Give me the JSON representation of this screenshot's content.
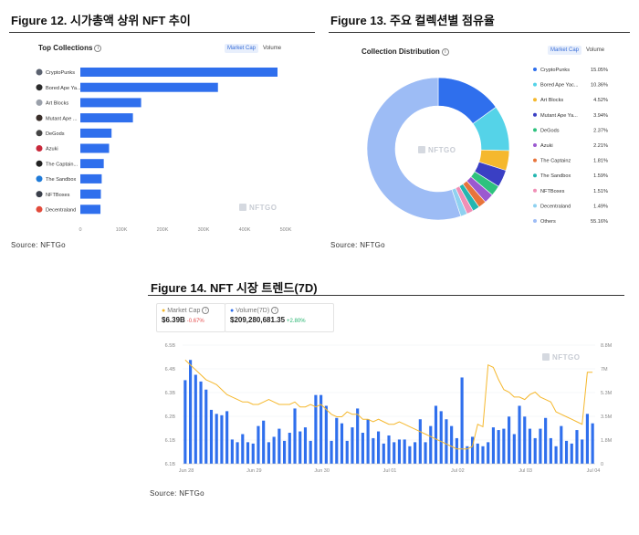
{
  "fig12": {
    "title": "Figure 12. 시가총액 상위 NFT 추이",
    "source": "Source: NFTGo",
    "panel_title": "Top Collections",
    "toggle_a": "Market Cap",
    "toggle_b": "Volume",
    "watermark": "NFTGO"
  },
  "fig13": {
    "title": "Figure 13. 주요 컬렉션별 점유율",
    "source": "Source: NFTGo",
    "panel_title": "Collection Distribution",
    "toggle_a": "Market Cap",
    "toggle_b": "Volume",
    "watermark": "NFTGO"
  },
  "fig14": {
    "title": "Figure 14. NFT 시장 트렌드(7D)",
    "source": "Source: NFTGo",
    "watermark": "NFTGO",
    "mc_label": "Market Cap",
    "mc_value": "$6.39B",
    "mc_change": "-0.67%",
    "vol_label": "Volume(7D)",
    "vol_value": "$209,280,681.35",
    "vol_change": "+2.80%"
  },
  "colors": {
    "bar": "#2f6fed",
    "line": "#f5b82e",
    "neg": "#e54d4d",
    "pos": "#20b26c"
  },
  "chart_data": [
    {
      "type": "bar",
      "orientation": "horizontal",
      "title": "Top Collections",
      "categories": [
        "CryptoPunks",
        "Bored Ape Ya...",
        "Art Blocks",
        "Mutant Ape ...",
        "DeGods",
        "Azuki",
        "The Captain...",
        "The Sandbox",
        "NFTBoxes",
        "Decentraland"
      ],
      "values": [
        480000,
        335000,
        148000,
        128000,
        76000,
        70000,
        57000,
        52000,
        50000,
        49000
      ],
      "xticks": [
        "0",
        "100K",
        "200K",
        "300K",
        "400K",
        "500K"
      ],
      "xlim": [
        0,
        500000
      ]
    },
    {
      "type": "pie",
      "title": "Collection Distribution",
      "labels": [
        "CryptoPunks",
        "Bored Ape Yac...",
        "Art Blocks",
        "Mutant Ape Ya...",
        "DeGods",
        "Azuki",
        "The Captainz",
        "The Sandbox",
        "NFTBoxes",
        "Decentraland",
        "Others"
      ],
      "values": [
        15.05,
        10.36,
        4.52,
        3.94,
        2.37,
        2.21,
        1.81,
        1.59,
        1.51,
        1.49,
        55.16
      ],
      "value_labels": [
        "15.05%",
        "10.36%",
        "4.52%",
        "3.94%",
        "2.37%",
        "2.21%",
        "1.81%",
        "1.59%",
        "1.51%",
        "1.49%",
        "55.16%"
      ],
      "colors": [
        "#2f6fed",
        "#55d3e8",
        "#f5b82e",
        "#3a3fc4",
        "#2ec27e",
        "#9b59d0",
        "#e8743b",
        "#24b6b0",
        "#f08fb6",
        "#8fd1f0",
        "#9dbcf5"
      ]
    },
    {
      "type": "bar+line",
      "x_ticks": [
        "Jun 28",
        "Jun 29",
        "Jun 30",
        "Jul 01",
        "Jul 02",
        "Jul 03",
        "Jul 04"
      ],
      "y_left_ticks": [
        "6.5B",
        "6.4B",
        "6.3B",
        "6.2B",
        "6.1B",
        "6.1B"
      ],
      "y_right_ticks": [
        "8.8M",
        "7M",
        "5.3M",
        "3.5M",
        "1.8M",
        "0"
      ],
      "series": [
        {
          "name": "Volume(7D)",
          "axis": "right",
          "values": [
            6.2,
            7.7,
            6.6,
            6.1,
            5.5,
            4.0,
            3.7,
            3.6,
            3.9,
            1.8,
            1.6,
            2.2,
            1.6,
            1.5,
            2.8,
            3.2,
            1.6,
            2.0,
            2.6,
            1.7,
            2.3,
            4.1,
            2.4,
            2.7,
            1.7,
            5.1,
            5.1,
            4.3,
            1.7,
            3.4,
            3.0,
            1.7,
            2.7,
            4.1,
            2.3,
            3.3,
            1.9,
            2.4,
            1.5,
            2.1,
            1.6,
            1.8,
            1.8,
            1.3,
            1.6,
            3.3,
            1.6,
            2.8,
            4.3,
            3.9,
            3.3,
            2.8,
            1.9,
            6.4,
            1.3,
            2.0,
            1.5,
            1.3,
            1.6,
            2.7,
            2.5,
            2.6,
            3.5,
            2.2,
            4.3,
            3.5,
            2.6,
            1.9,
            2.6,
            3.4,
            1.9,
            1.3,
            2.8,
            1.7,
            1.5,
            2.5,
            1.8,
            3.7,
            3.0
          ],
          "unit": "M"
        },
        {
          "name": "Market Cap",
          "axis": "left",
          "values": [
            6.52,
            6.5,
            6.48,
            6.46,
            6.44,
            6.43,
            6.42,
            6.4,
            6.38,
            6.37,
            6.36,
            6.35,
            6.35,
            6.34,
            6.34,
            6.35,
            6.36,
            6.35,
            6.34,
            6.34,
            6.34,
            6.35,
            6.33,
            6.33,
            6.34,
            6.33,
            6.34,
            6.32,
            6.3,
            6.29,
            6.29,
            6.31,
            6.3,
            6.3,
            6.28,
            6.28,
            6.27,
            6.28,
            6.27,
            6.26,
            6.26,
            6.27,
            6.26,
            6.25,
            6.24,
            6.23,
            6.22,
            6.21,
            6.2,
            6.19,
            6.18,
            6.17,
            6.16,
            6.16,
            6.16,
            6.17,
            6.26,
            6.25,
            6.5,
            6.49,
            6.44,
            6.4,
            6.39,
            6.37,
            6.37,
            6.36,
            6.38,
            6.39,
            6.37,
            6.36,
            6.35,
            6.31,
            6.3,
            6.29,
            6.28,
            6.27,
            6.26,
            6.47,
            6.47
          ],
          "unit": "B"
        }
      ]
    }
  ]
}
